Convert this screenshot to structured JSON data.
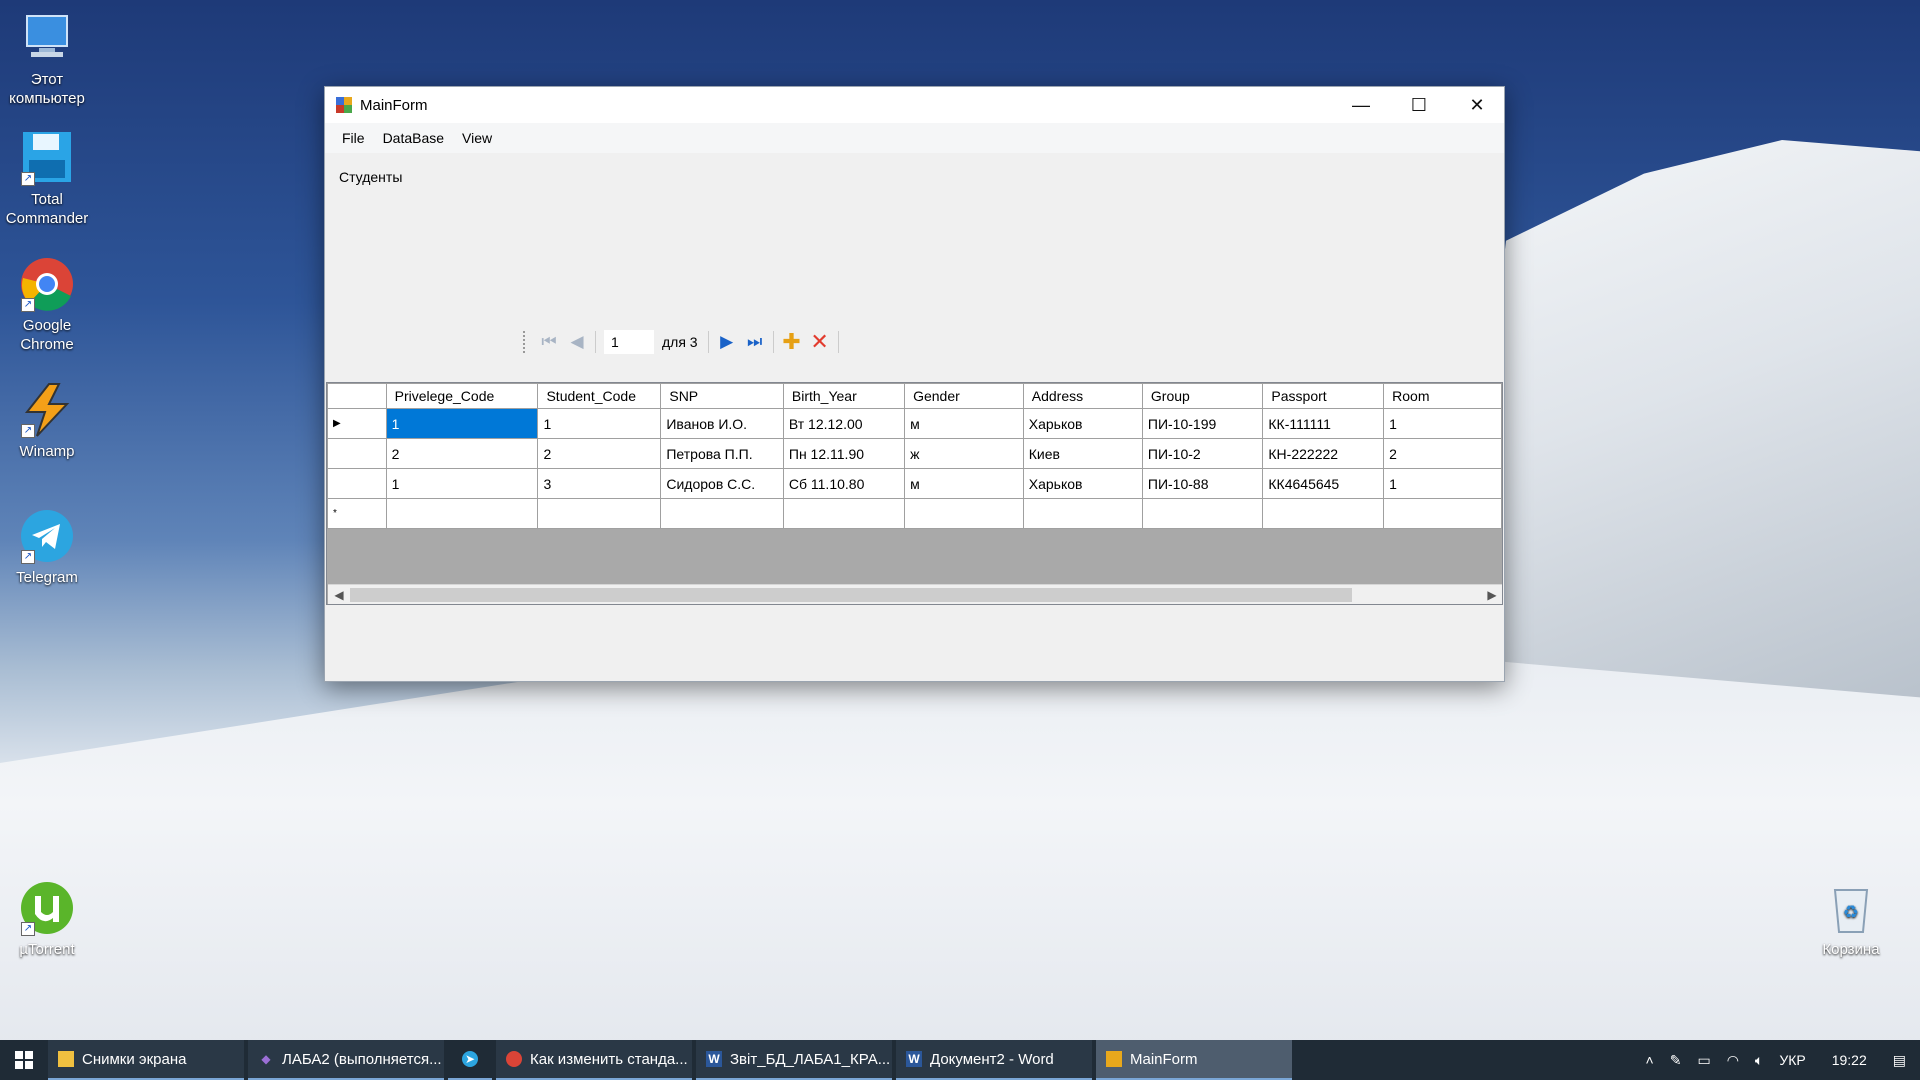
{
  "desktop": {
    "icons": [
      {
        "label": "Этот\nкомпьютер"
      },
      {
        "label": "Total\nCommander"
      },
      {
        "label": "Google\nChrome"
      },
      {
        "label": "Winamp"
      },
      {
        "label": "Telegram"
      },
      {
        "label": "µTorrent"
      },
      {
        "label": "Корзина"
      }
    ]
  },
  "window": {
    "title": "MainForm",
    "controls": {
      "minimize": "—",
      "maximize": "☐",
      "close": "✕"
    }
  },
  "menu": {
    "items": [
      "File",
      "DataBase",
      "View"
    ]
  },
  "caption": "Студенты",
  "navigator": {
    "position": "1",
    "count_label": "для 3"
  },
  "grid": {
    "columns": [
      "Privelege_Code",
      "Student_Code",
      "SNP",
      "Birth_Year",
      "Gender",
      "Address",
      "Group",
      "Passport",
      "Room"
    ],
    "rows": [
      [
        "1",
        "1",
        "Иванов И.О.",
        "Вт 12.12.00",
        "м",
        "Харьков",
        "ПИ-10-199",
        "КК-111111",
        "1"
      ],
      [
        "2",
        "2",
        "Петрова П.П.",
        "Пн 12.11.90",
        "ж",
        "Киев",
        "ПИ-10-2",
        "КН-222222",
        "2"
      ],
      [
        "1",
        "3",
        "Сидоров С.С.",
        "Сб 11.10.80",
        "м",
        "Харьков",
        "ПИ-10-88",
        "КК4645645",
        "1"
      ]
    ],
    "new_row_marker": "*",
    "current_row_marker": "▶"
  },
  "taskbar": {
    "items": [
      {
        "label": "Снимки экрана"
      },
      {
        "label": "ЛАБА2 (выполняется..."
      },
      {
        "label": ""
      },
      {
        "label": "Как изменить станда..."
      },
      {
        "label": "Звіт_БД_ЛАБА1_КРА..."
      },
      {
        "label": "Документ2 - Word"
      },
      {
        "label": "MainForm"
      }
    ],
    "tray": {
      "language": "УКР",
      "time": "19:22"
    }
  },
  "colors": {
    "selection": "#0078d7",
    "taskbar": "#1f2b36"
  }
}
